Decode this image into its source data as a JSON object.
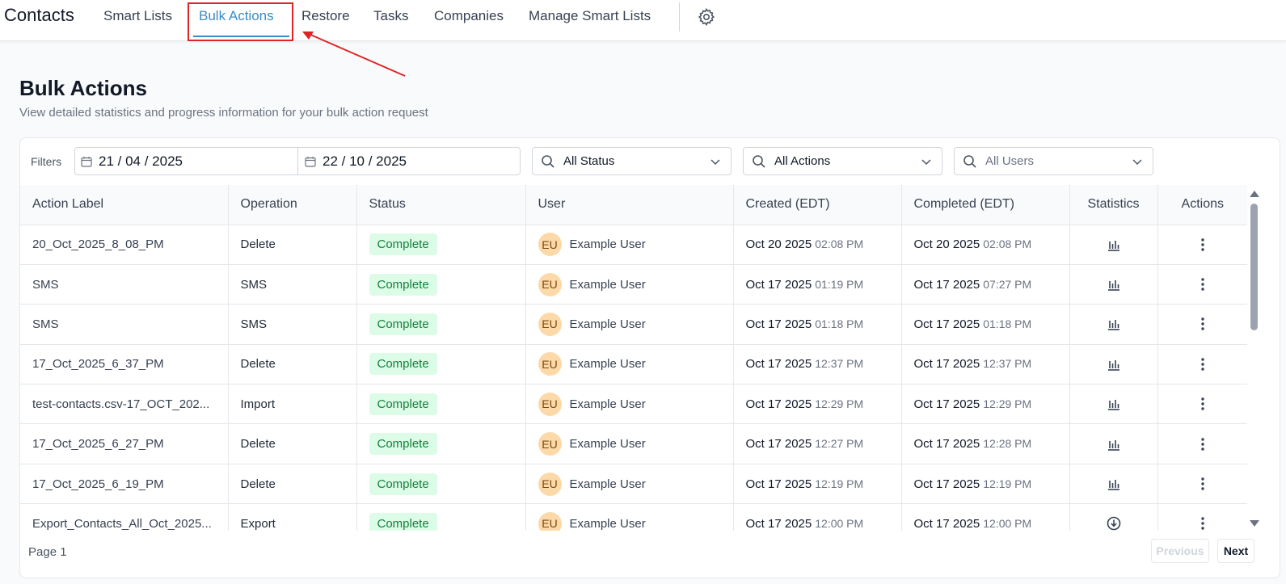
{
  "app_title": "Contacts",
  "nav": {
    "tabs": [
      "Smart Lists",
      "Bulk Actions",
      "Restore",
      "Tasks",
      "Companies",
      "Manage Smart Lists"
    ],
    "active": "Bulk Actions",
    "settings_icon": "gear-icon"
  },
  "header": {
    "title": "Bulk Actions",
    "subtitle": "View detailed statistics and progress information for your bulk action request"
  },
  "filters": {
    "label": "Filters",
    "date_start": "21 / 04 / 2025",
    "date_end": "22 / 10 / 2025",
    "status": "All Status",
    "actions": "All Actions",
    "users": "All Users"
  },
  "table": {
    "columns": [
      "Action Label",
      "Operation",
      "Status",
      "User",
      "Created (EDT)",
      "Completed (EDT)",
      "Statistics",
      "Actions"
    ],
    "rows": [
      {
        "label": "20_Oct_2025_8_08_PM",
        "operation": "Delete",
        "status": "Complete",
        "initials": "EU",
        "user": "Example User",
        "created_date": "Oct 20 2025",
        "created_time": "02:08 PM",
        "completed_date": "Oct 20 2025",
        "completed_time": "02:08 PM",
        "stat_icon": "bar-chart-icon"
      },
      {
        "label": "SMS",
        "operation": "SMS",
        "status": "Complete",
        "initials": "EU",
        "user": "Example User",
        "created_date": "Oct 17 2025",
        "created_time": "01:19 PM",
        "completed_date": "Oct 17 2025",
        "completed_time": "07:27 PM",
        "stat_icon": "bar-chart-icon"
      },
      {
        "label": "SMS",
        "operation": "SMS",
        "status": "Complete",
        "initials": "EU",
        "user": "Example User",
        "created_date": "Oct 17 2025",
        "created_time": "01:18 PM",
        "completed_date": "Oct 17 2025",
        "completed_time": "01:18 PM",
        "stat_icon": "bar-chart-icon"
      },
      {
        "label": "17_Oct_2025_6_37_PM",
        "operation": "Delete",
        "status": "Complete",
        "initials": "EU",
        "user": "Example User",
        "created_date": "Oct 17 2025",
        "created_time": "12:37 PM",
        "completed_date": "Oct 17 2025",
        "completed_time": "12:37 PM",
        "stat_icon": "bar-chart-icon"
      },
      {
        "label": "test-contacts.csv-17_OCT_202...",
        "operation": "Import",
        "status": "Complete",
        "initials": "EU",
        "user": "Example User",
        "created_date": "Oct 17 2025",
        "created_time": "12:29 PM",
        "completed_date": "Oct 17 2025",
        "completed_time": "12:29 PM",
        "stat_icon": "bar-chart-icon"
      },
      {
        "label": "17_Oct_2025_6_27_PM",
        "operation": "Delete",
        "status": "Complete",
        "initials": "EU",
        "user": "Example User",
        "created_date": "Oct 17 2025",
        "created_time": "12:27 PM",
        "completed_date": "Oct 17 2025",
        "completed_time": "12:28 PM",
        "stat_icon": "bar-chart-icon"
      },
      {
        "label": "17_Oct_2025_6_19_PM",
        "operation": "Delete",
        "status": "Complete",
        "initials": "EU",
        "user": "Example User",
        "created_date": "Oct 17 2025",
        "created_time": "12:19 PM",
        "completed_date": "Oct 17 2025",
        "completed_time": "12:19 PM",
        "stat_icon": "bar-chart-icon"
      },
      {
        "label": "Export_Contacts_All_Oct_2025...",
        "operation": "Export",
        "status": "Complete",
        "initials": "EU",
        "user": "Example User",
        "created_date": "Oct 17 2025",
        "created_time": "12:00 PM",
        "completed_date": "Oct 17 2025",
        "completed_time": "12:00 PM",
        "stat_icon": "download-icon"
      }
    ]
  },
  "pagination": {
    "page_label": "Page 1",
    "previous": "Previous",
    "next": "Next"
  },
  "colors": {
    "accent": "#3b8bc4",
    "annotation": "#e02424",
    "status_bg": "#dcfce7",
    "status_text": "#15803d",
    "avatar_bg": "#fcd9a8"
  }
}
